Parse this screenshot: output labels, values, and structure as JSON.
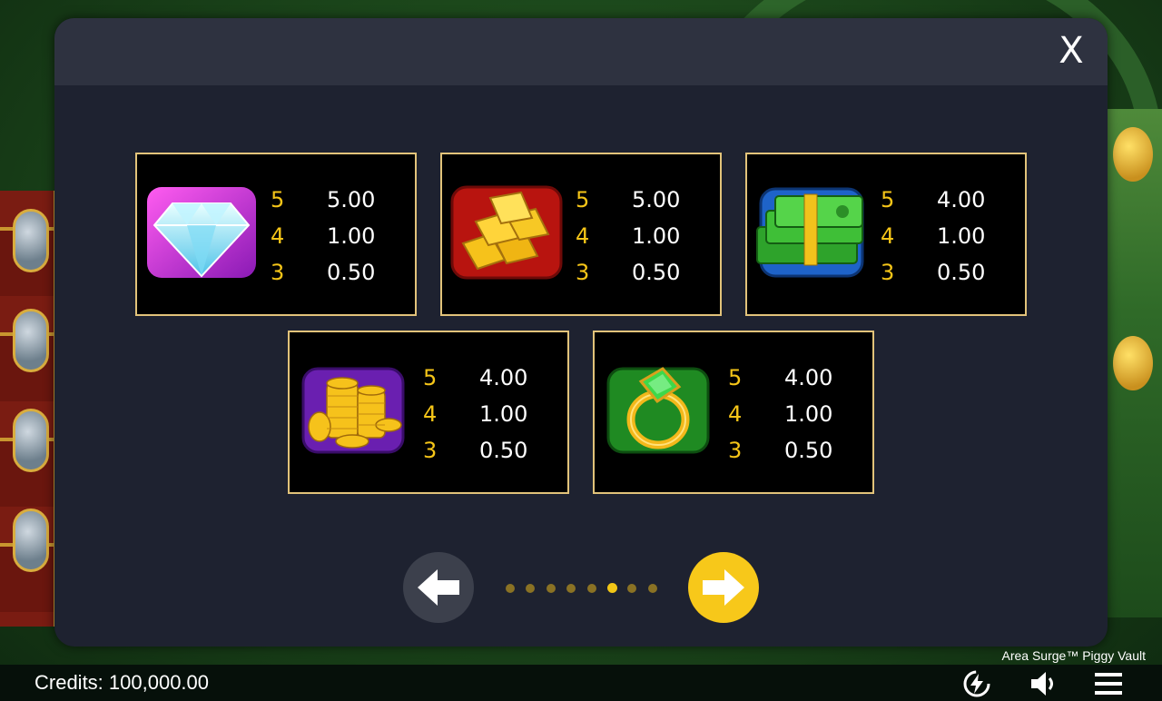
{
  "game": {
    "title": "Area Surge™ Piggy Vault"
  },
  "modal": {
    "close_label": "X"
  },
  "paytable": [
    {
      "symbol": "diamond-gem-icon",
      "rows": [
        {
          "count": "5",
          "amount": "5.00"
        },
        {
          "count": "4",
          "amount": "1.00"
        },
        {
          "count": "3",
          "amount": "0.50"
        }
      ]
    },
    {
      "symbol": "gold-bars-icon",
      "rows": [
        {
          "count": "5",
          "amount": "5.00"
        },
        {
          "count": "4",
          "amount": "1.00"
        },
        {
          "count": "3",
          "amount": "0.50"
        }
      ]
    },
    {
      "symbol": "cash-stack-icon",
      "rows": [
        {
          "count": "5",
          "amount": "4.00"
        },
        {
          "count": "4",
          "amount": "1.00"
        },
        {
          "count": "3",
          "amount": "0.50"
        }
      ]
    },
    {
      "symbol": "gold-coins-icon",
      "rows": [
        {
          "count": "5",
          "amount": "4.00"
        },
        {
          "count": "4",
          "amount": "1.00"
        },
        {
          "count": "3",
          "amount": "0.50"
        }
      ]
    },
    {
      "symbol": "emerald-ring-icon",
      "rows": [
        {
          "count": "5",
          "amount": "4.00"
        },
        {
          "count": "4",
          "amount": "1.00"
        },
        {
          "count": "3",
          "amount": "0.50"
        }
      ]
    }
  ],
  "pagination": {
    "total_pages": 8,
    "current_page": 6
  },
  "footer": {
    "credits_label": "Credits: 100,000.00",
    "icons": [
      "turbo-icon",
      "sound-icon",
      "menu-icon"
    ]
  },
  "colors": {
    "accent": "#f7c81a",
    "card_border": "#e2c37a",
    "modal_bg": "#1e2230",
    "header_bg": "#2e3240"
  }
}
